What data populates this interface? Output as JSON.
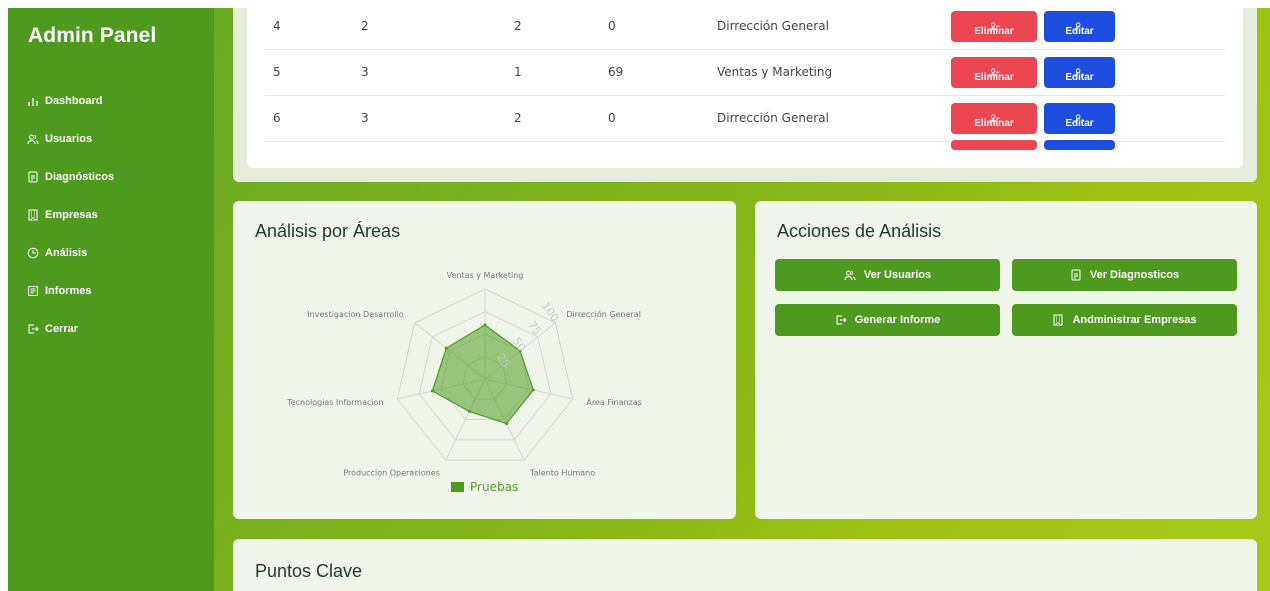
{
  "sidebar": {
    "title": "Admin Panel",
    "items": [
      {
        "label": "Dashboard",
        "icon": "bar-chart-icon"
      },
      {
        "label": "Usuarios",
        "icon": "users-icon"
      },
      {
        "label": "Diagnósticos",
        "icon": "document-icon"
      },
      {
        "label": "Empresas",
        "icon": "building-icon"
      },
      {
        "label": "Análisis",
        "icon": "clock-icon"
      },
      {
        "label": "Informes",
        "icon": "report-icon"
      },
      {
        "label": "Cerrar",
        "icon": "logout-icon"
      }
    ]
  },
  "table": {
    "rows": [
      {
        "c1": "4",
        "c2": "2",
        "c3": "2",
        "c4": "0",
        "area": "Dirrección General"
      },
      {
        "c1": "5",
        "c2": "3",
        "c3": "1",
        "c4": "69",
        "area": "Ventas y Marketing"
      },
      {
        "c1": "6",
        "c2": "3",
        "c3": "2",
        "c4": "0",
        "area": "Dirrección General"
      }
    ],
    "delete_label": "Eliminar",
    "edit_label": "Editar"
  },
  "radar": {
    "title": "Análisis por Áreas",
    "legend": "Pruebas",
    "colors": {
      "fill": "#4e9a1f",
      "grid": "#d6d6d6"
    }
  },
  "chart_data": {
    "type": "radar",
    "categories": [
      "Ventas y Marketing",
      "Dirrección General",
      "Área Finanzas",
      "Talento Humano",
      "Produccion Operaciones",
      "Tecnologias Informacion",
      "Investigacion Desarrollo"
    ],
    "series": [
      {
        "name": "Pruebas",
        "values": [
          60,
          50,
          55,
          55,
          40,
          60,
          55
        ]
      }
    ],
    "ticks": [
      "25",
      "50",
      "75",
      "100"
    ],
    "rmax": 100
  },
  "actions": {
    "title": "Acciones de Análisis",
    "buttons": [
      {
        "label": "Ver Usuarios",
        "icon": "users-icon"
      },
      {
        "label": "Ver Diagnosticos",
        "icon": "document-icon"
      },
      {
        "label": "Generar Informe",
        "icon": "logout-icon"
      },
      {
        "label": "Andministrar Empresas",
        "icon": "building-icon"
      }
    ]
  },
  "key_points": {
    "title": "Puntos Clave"
  }
}
